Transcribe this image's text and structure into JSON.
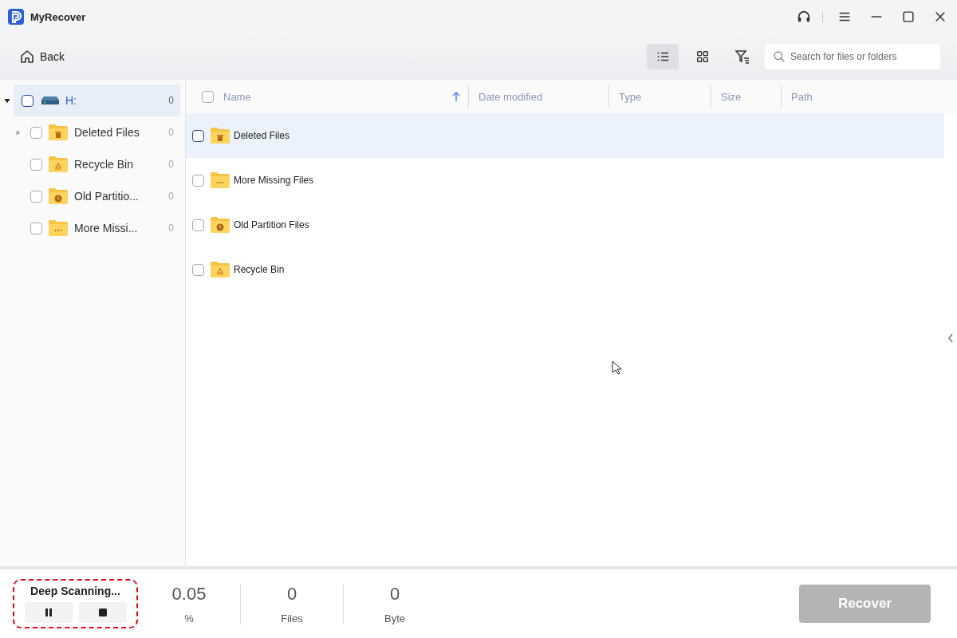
{
  "window": {
    "title": "MyRecover"
  },
  "toolbar": {
    "back": "Back",
    "views": [
      {
        "kind": "list",
        "selected": true
      },
      {
        "kind": "grid",
        "selected": false
      }
    ],
    "search": {
      "placeholder": "Search for files or folders"
    }
  },
  "tree": [
    {
      "label": "H:",
      "count": "0",
      "kind": "drive",
      "selected": true,
      "checked": false,
      "has_children": true,
      "expanded": true,
      "children": [
        {
          "label": "Deleted Files",
          "count": "0",
          "kind": "trash",
          "selected": false,
          "checked": false,
          "has_children": true,
          "expanded": false
        },
        {
          "label": "Recycle Bin",
          "count": "0",
          "kind": "recycle",
          "selected": false,
          "checked": false,
          "has_children": false
        },
        {
          "label": "Old Partitio...",
          "count": "0",
          "kind": "clock",
          "selected": false,
          "checked": false,
          "has_children": false
        },
        {
          "label": "More Missi...",
          "count": "0",
          "kind": "dots",
          "selected": false,
          "checked": false,
          "has_children": false
        }
      ]
    }
  ],
  "table": {
    "select_all_checked": false,
    "columns": [
      {
        "label": "Name",
        "sorted": true
      },
      {
        "label": "Date modified",
        "sorted": false
      },
      {
        "label": "Type",
        "sorted": false
      },
      {
        "label": "Size",
        "sorted": false
      },
      {
        "label": "Path",
        "sorted": false
      }
    ],
    "rows": [
      {
        "name": "Deleted Files",
        "kind": "trash",
        "selected": true,
        "checked": false
      },
      {
        "name": "More Missing Files",
        "kind": "dots",
        "selected": false,
        "checked": false
      },
      {
        "name": "Old Partition Files",
        "kind": "clock",
        "selected": false,
        "checked": false
      },
      {
        "name": "Recycle Bin",
        "kind": "recycle",
        "selected": false,
        "checked": false
      }
    ]
  },
  "status_bar": {
    "scan_label": "Deep Scanning...",
    "stats": [
      {
        "value": "0.05",
        "unit": "%"
      },
      {
        "value": "0",
        "unit": "Files"
      },
      {
        "value": "0",
        "unit": "Byte"
      }
    ],
    "recover": {
      "label": "Recover",
      "disabled": true
    }
  }
}
